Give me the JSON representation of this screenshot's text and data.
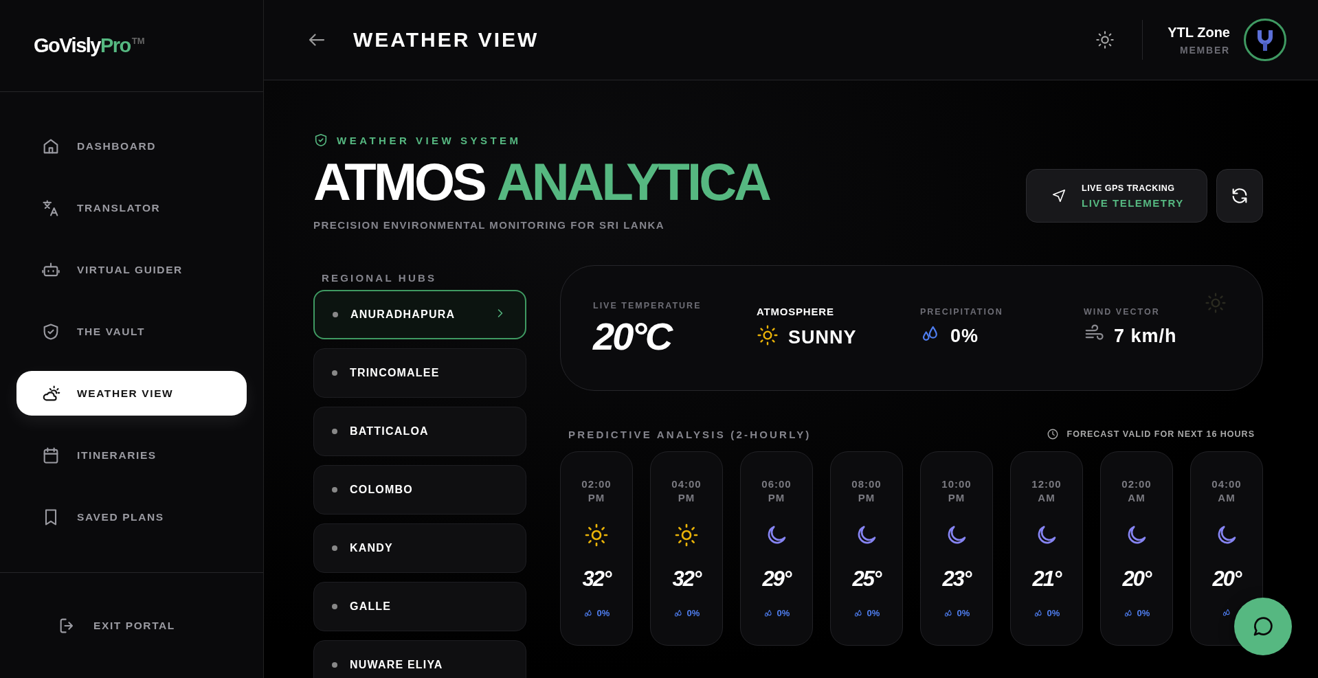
{
  "brand": {
    "name": "GoVisly",
    "accent": "Pro",
    "mark": "TM"
  },
  "sidebar": {
    "items": [
      {
        "label": "DASHBOARD",
        "kind": "home",
        "selected": false
      },
      {
        "label": "TRANSLATOR",
        "kind": "translate",
        "selected": false
      },
      {
        "label": "VIRTUAL GUIDER",
        "kind": "robot",
        "selected": false
      },
      {
        "label": "THE VAULT",
        "kind": "shield",
        "selected": false
      },
      {
        "label": "WEATHER VIEW",
        "kind": "weather",
        "selected": true
      },
      {
        "label": "ITINERARIES",
        "kind": "calendar",
        "selected": false
      },
      {
        "label": "SAVED PLANS",
        "kind": "bookmark",
        "selected": false
      }
    ],
    "exit": "EXIT PORTAL"
  },
  "header": {
    "title": "WEATHER VIEW",
    "user": {
      "name": "YTL Zone",
      "role": "MEMBER"
    }
  },
  "hero": {
    "eyebrow": "WEATHER VIEW SYSTEM",
    "title": "ATMOS",
    "title_accent": "ANALYTICA",
    "tagline": "PRECISION ENVIRONMENTAL MONITORING FOR SRI LANKA"
  },
  "tracking": {
    "label": "LIVE GPS TRACKING",
    "status": "LIVE TELEMETRY"
  },
  "hubs": {
    "title": "REGIONAL HUBS",
    "items": [
      {
        "name": "ANURADHAPURA",
        "selected": true
      },
      {
        "name": "TRINCOMALEE",
        "selected": false
      },
      {
        "name": "BATTICALOA",
        "selected": false
      },
      {
        "name": "COLOMBO",
        "selected": false
      },
      {
        "name": "KANDY",
        "selected": false
      },
      {
        "name": "GALLE",
        "selected": false
      },
      {
        "name": "NUWARE ELIYA",
        "selected": false
      }
    ]
  },
  "current": {
    "metrics": [
      {
        "kind": "temperature",
        "label": "LIVE TEMPERATURE",
        "value": "20°C"
      },
      {
        "kind": "condition",
        "label": "ATMOSPHERE",
        "value": "SUNNY"
      },
      {
        "kind": "precipitation",
        "label": "PRECIPITATION",
        "value": "0%"
      },
      {
        "kind": "wind",
        "label": "WIND VECTOR",
        "value": "7 km/h"
      }
    ]
  },
  "forecast": {
    "title": "PREDICTIVE ANALYSIS (2-HOURLY)",
    "note": "FORECAST VALID FOR NEXT 16 HOURS",
    "hours": [
      {
        "time": "02:00",
        "period": "PM",
        "kind": "day",
        "temp": "32°",
        "rain": "0%"
      },
      {
        "time": "04:00",
        "period": "PM",
        "kind": "day",
        "temp": "32°",
        "rain": "0%"
      },
      {
        "time": "06:00",
        "period": "PM",
        "kind": "night",
        "temp": "29°",
        "rain": "0%"
      },
      {
        "time": "08:00",
        "period": "PM",
        "kind": "night",
        "temp": "25°",
        "rain": "0%"
      },
      {
        "time": "10:00",
        "period": "PM",
        "kind": "night",
        "temp": "23°",
        "rain": "0%"
      },
      {
        "time": "12:00",
        "period": "AM",
        "kind": "night",
        "temp": "21°",
        "rain": "0%"
      },
      {
        "time": "02:00",
        "period": "AM",
        "kind": "night",
        "temp": "20°",
        "rain": "0%"
      },
      {
        "time": "04:00",
        "period": "AM",
        "kind": "night",
        "temp": "20°"
      }
    ]
  }
}
